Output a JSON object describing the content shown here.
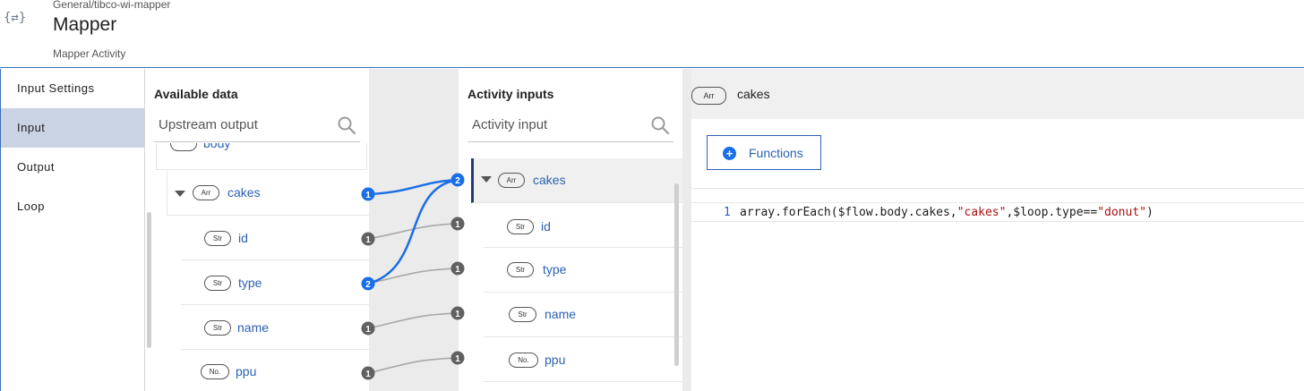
{
  "header": {
    "breadcrumb": "General/tibco-wi-mapper",
    "title": "Mapper",
    "subtitle": "Mapper Activity",
    "icon": "mapper-icon"
  },
  "nav": {
    "items": [
      {
        "label": "Input Settings",
        "active": false
      },
      {
        "label": "Input",
        "active": true
      },
      {
        "label": "Output",
        "active": false
      },
      {
        "label": "Loop",
        "active": false
      }
    ]
  },
  "available": {
    "title": "Available data",
    "search_placeholder": "Upstream output",
    "partial_row_label": "body",
    "rows": [
      {
        "type": "Arr",
        "label": "cakes",
        "badge": "1"
      },
      {
        "type": "Str",
        "label": "id",
        "badge": "1"
      },
      {
        "type": "Str",
        "label": "type",
        "badge": "2"
      },
      {
        "type": "Str",
        "label": "name",
        "badge": "1"
      },
      {
        "type": "No.",
        "label": "ppu",
        "badge": "1"
      }
    ]
  },
  "activity": {
    "title": "Activity inputs",
    "search_placeholder": "Activity input",
    "rows": [
      {
        "type": "Arr",
        "label": "cakes",
        "badge": "2"
      },
      {
        "type": "Str",
        "label": "id",
        "badge": "1"
      },
      {
        "type": "Str",
        "label": "type",
        "badge": "1"
      },
      {
        "type": "Str",
        "label": "name",
        "badge": "1"
      },
      {
        "type": "No.",
        "label": "ppu",
        "badge": "1"
      }
    ]
  },
  "editor": {
    "type": "Arr",
    "title": "cakes",
    "functions_label": "Functions",
    "line_number": "1",
    "code_prefix": "array.forEach($flow.body.cakes,",
    "code_str1": "\"cakes\"",
    "code_mid": ",$loop.type==",
    "code_str2": "\"donut\"",
    "code_suffix": ")"
  },
  "colors": {
    "accent": "#1a6ee6",
    "mapped_line": "#1a6ee6",
    "unmapped_line": "#9e9e9e",
    "badge_inactive": "#616161"
  }
}
